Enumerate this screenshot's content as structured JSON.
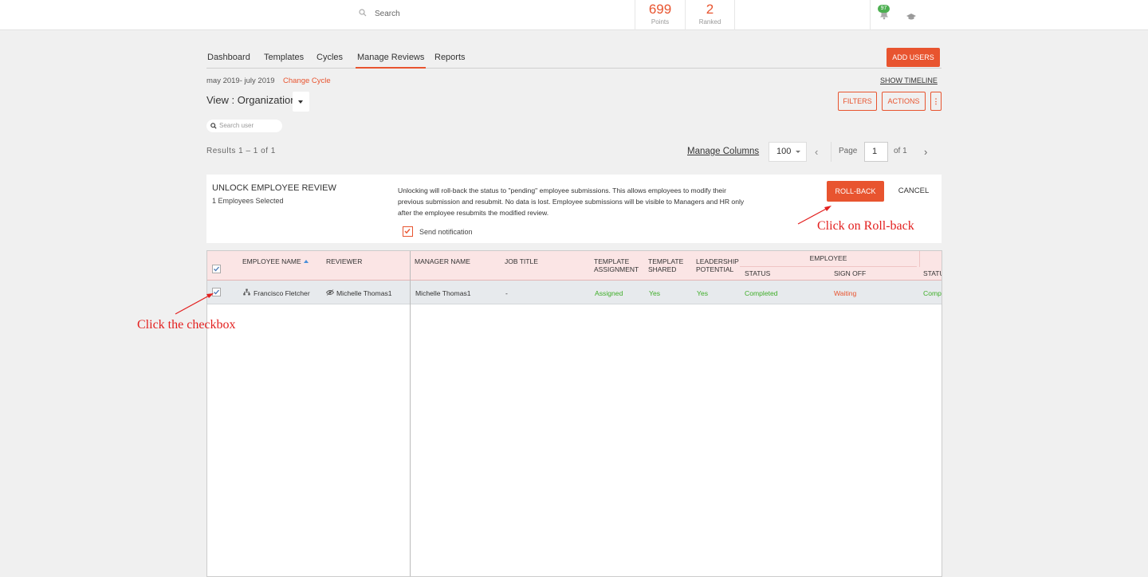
{
  "header": {
    "search_placeholder": "Search",
    "points_value": "699",
    "points_label": "Points",
    "ranked_value": "2",
    "ranked_label": "Ranked",
    "notification_count": "97",
    "icons": [
      "search-icon",
      "bell-icon",
      "graduation-cap-icon"
    ]
  },
  "tabs": [
    {
      "label": "Dashboard",
      "active": false
    },
    {
      "label": "Templates",
      "active": false
    },
    {
      "label": "Cycles",
      "active": false
    },
    {
      "label": "Manage Reviews",
      "active": true
    },
    {
      "label": "Reports",
      "active": false
    }
  ],
  "toolbar": {
    "add_users": "ADD USERS",
    "cycle_range": "may 2019- july 2019",
    "change_cycle": "Change Cycle",
    "show_timeline": "SHOW TIMELINE",
    "view_label": "View : Organization",
    "filters": "FILTERS",
    "actions": "ACTIONS",
    "more": "⋮",
    "search_user_placeholder": "Search user",
    "results": "Results 1 – 1 of 1",
    "manage_columns": "Manage Columns",
    "per_page": "100",
    "page_label": "Page",
    "page_value": "1",
    "page_of": "of 1"
  },
  "unlock": {
    "title": "UNLOCK EMPLOYEE REVIEW",
    "selected": "1 Employees Selected",
    "description": "Unlocking will roll-back the status to \"pending\" employee submissions. This allows employees to modify their previous submission and resubmit. No data is lost. Employee submissions will be visible to Managers and HR only after the employee resubmits the modified review.",
    "send_notification": "Send notification",
    "send_notification_checked": true,
    "rollback": "ROLL-BACK",
    "cancel": "CANCEL"
  },
  "grid": {
    "headers": {
      "employee_name": "EMPLOYEE NAME",
      "reviewer": "REVIEWER",
      "manager_name": "MANAGER NAME",
      "job_title": "JOB TITLE",
      "template_assignment_1": "TEMPLATE",
      "template_assignment_2": "ASSIGNMENT",
      "template_shared_1": "TEMPLATE",
      "template_shared_2": "SHARED",
      "leadership_1": "LEADERSHIP",
      "leadership_2": "POTENTIAL",
      "employee_group": "EMPLOYEE",
      "status": "STATUS",
      "sign_off": "SIGN OFF",
      "status_2": "STATU"
    },
    "rows": [
      {
        "checked": true,
        "employee_name": "Francisco Fletcher",
        "reviewer": "Michelle Thomas1",
        "manager_name": "Michelle Thomas1",
        "job_title": "-",
        "template_assignment": "Assigned",
        "template_shared": "Yes",
        "leadership_potential": "Yes",
        "status": "Completed",
        "sign_off": "Waiting",
        "status_2": "Comp"
      }
    ]
  },
  "annotations": {
    "rollback_hint": "Click on Roll-back",
    "checkbox_hint": "Click the checkbox"
  },
  "colors": {
    "accent": "#e8542f",
    "success": "#3fae29",
    "annotation": "#e3201f",
    "header_row": "#fbe5e5"
  }
}
